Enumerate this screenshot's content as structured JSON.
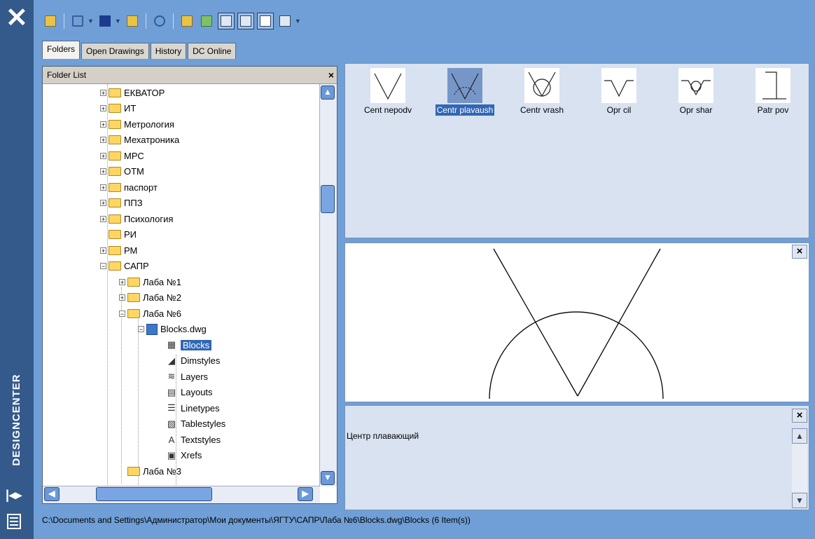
{
  "window": {
    "vertical_title": "DESIGNCENTER",
    "accent": "#345a8c"
  },
  "toolbar": {
    "icons": [
      "load-icon",
      "back-icon",
      "forward-icon",
      "up-icon",
      "search-icon",
      "favorites-icon",
      "home-icon",
      "tree-toggle-icon",
      "preview-icon",
      "description-icon",
      "views-icon"
    ]
  },
  "tabs": [
    "Folders",
    "Open Drawings",
    "History",
    "DC Online"
  ],
  "tree": {
    "header": "Folder List",
    "nodes": [
      {
        "label": "ЕКВАТОР",
        "level": 0,
        "exp": "+",
        "kind": "folder"
      },
      {
        "label": "ИТ",
        "level": 0,
        "exp": "+",
        "kind": "folder"
      },
      {
        "label": "Метрология",
        "level": 0,
        "exp": "+",
        "kind": "folder"
      },
      {
        "label": "Мехатроника",
        "level": 0,
        "exp": "+",
        "kind": "folder"
      },
      {
        "label": "МРС",
        "level": 0,
        "exp": "+",
        "kind": "folder"
      },
      {
        "label": "ОТМ",
        "level": 0,
        "exp": "+",
        "kind": "folder"
      },
      {
        "label": "паспорт",
        "level": 0,
        "exp": "+",
        "kind": "folder"
      },
      {
        "label": "ППЗ",
        "level": 0,
        "exp": "+",
        "kind": "folder"
      },
      {
        "label": "Психология",
        "level": 0,
        "exp": "+",
        "kind": "folder"
      },
      {
        "label": "РИ",
        "level": 0,
        "exp": "",
        "kind": "folder"
      },
      {
        "label": "РМ",
        "level": 0,
        "exp": "+",
        "kind": "folder"
      },
      {
        "label": "САПР",
        "level": 0,
        "exp": "-",
        "kind": "folder"
      },
      {
        "label": "Лаба №1",
        "level": 1,
        "exp": "+",
        "kind": "folder"
      },
      {
        "label": "Лаба №2",
        "level": 1,
        "exp": "+",
        "kind": "folder"
      },
      {
        "label": "Лаба №6",
        "level": 1,
        "exp": "-",
        "kind": "folder"
      },
      {
        "label": "Blocks.dwg",
        "level": 2,
        "exp": "-",
        "kind": "dwg"
      },
      {
        "label": "Blocks",
        "level": 3,
        "exp": "",
        "kind": "blocks",
        "selected": true
      },
      {
        "label": "Dimstyles",
        "level": 3,
        "exp": "",
        "kind": "dim"
      },
      {
        "label": "Layers",
        "level": 3,
        "exp": "",
        "kind": "layers"
      },
      {
        "label": "Layouts",
        "level": 3,
        "exp": "",
        "kind": "layouts"
      },
      {
        "label": "Linetypes",
        "level": 3,
        "exp": "",
        "kind": "linetypes"
      },
      {
        "label": "Tablestyles",
        "level": 3,
        "exp": "",
        "kind": "tablestyles"
      },
      {
        "label": "Textstyles",
        "level": 3,
        "exp": "",
        "kind": "textstyles"
      },
      {
        "label": "Xrefs",
        "level": 3,
        "exp": "",
        "kind": "xrefs"
      },
      {
        "label": "Лаба №3",
        "level": 1,
        "exp": "",
        "kind": "folder"
      }
    ]
  },
  "palette": {
    "items": [
      {
        "label": "Cent nepodv",
        "shape": "v"
      },
      {
        "label": "Centr plavaush",
        "shape": "vdot",
        "selected": true
      },
      {
        "label": "Centr vrash",
        "shape": "vring"
      },
      {
        "label": "Opr cil",
        "shape": "oprcil"
      },
      {
        "label": "Opr shar",
        "shape": "oprshar"
      },
      {
        "label": "Patr pov",
        "shape": "patr"
      }
    ]
  },
  "description": {
    "text": "Центр плавающий"
  },
  "status": {
    "path": "C:\\Documents and Settings\\Администратор\\Мои документы\\ЯГТУ\\САПР\\Лаба №6\\Blocks.dwg\\Blocks (6 Item(s))"
  }
}
